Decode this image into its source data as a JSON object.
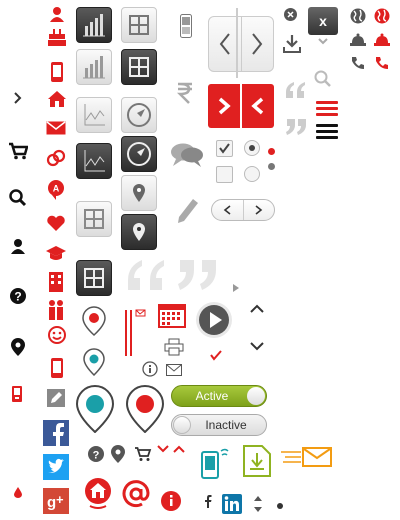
{
  "toggles": {
    "active_label": "Active",
    "inactive_label": "Inactive"
  },
  "colors": {
    "accent": "#e02020",
    "active_green": "#8fb321",
    "dark": "#333333",
    "social_facebook": "#3b5998",
    "social_twitter": "#1da1f2",
    "social_google": "#d34836",
    "linkedin": "#0e76a8",
    "teal": "#1a9fa8",
    "orange": "#f39c12"
  },
  "icons": [
    "chevron-right-icon",
    "cart-icon",
    "search-info-icon",
    "user-icon",
    "help-icon",
    "map-pin-icon",
    "phone-icon",
    "drop-icon",
    "user-icon",
    "cake-icon",
    "mobile-icon",
    "home-icon",
    "mail-icon",
    "link-icon",
    "group-icon",
    "heart-icon",
    "graduation-icon",
    "building-icon",
    "people-icon",
    "smiley-icon",
    "mobile-icon",
    "edit-icon",
    "facebook-icon",
    "twitter-icon",
    "google-plus-icon",
    "bar-chart-icon",
    "line-chart-icon",
    "grid-icon",
    "compass-icon",
    "map-pin-icon",
    "phone-icon",
    "rupee-icon",
    "chat-icon",
    "pencil-icon",
    "chevron-left-icon",
    "chevron-right-icon",
    "checkbox-icon",
    "radio-icon",
    "quote-icon",
    "close-icon",
    "download-icon",
    "search-icon",
    "menu-icon",
    "globe-icon",
    "bell-icon",
    "phone-icon",
    "calendar-icon",
    "print-icon",
    "play-icon",
    "info-icon",
    "mail-icon",
    "checkmark-icon",
    "chevron-up-icon",
    "chevron-down-icon",
    "linkedin-icon",
    "scroll-icon"
  ],
  "close_label": "x"
}
